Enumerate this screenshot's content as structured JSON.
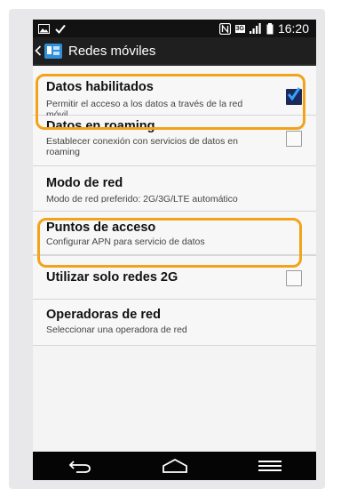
{
  "status": {
    "time": "16:20",
    "network_type": "3G"
  },
  "actionbar": {
    "title": "Redes móviles"
  },
  "settings": [
    {
      "title": "Datos habilitados",
      "subtitle": "Permitir el acceso a los datos a través de la red móvil",
      "checked": true
    },
    {
      "title": "Datos en roaming",
      "subtitle": "Establecer conexión con servicios de datos en roaming",
      "checked": false
    },
    {
      "title": "Modo de red",
      "subtitle": "Modo de red preferido: 2G/3G/LTE automático"
    },
    {
      "title": "Puntos de acceso",
      "subtitle": "Configurar APN para servicio de datos"
    },
    {
      "title": "Utilizar solo redes 2G",
      "checked": false
    },
    {
      "title": "Operadoras de red",
      "subtitle": "Seleccionar una operadora de red"
    }
  ],
  "colors": {
    "highlight": "#f2a31a",
    "check": "#1e7dd6",
    "checkbox_bg": "#1a2a5a"
  },
  "icons": {
    "back": "back-icon",
    "home": "home-icon",
    "menu": "menu-icon"
  }
}
